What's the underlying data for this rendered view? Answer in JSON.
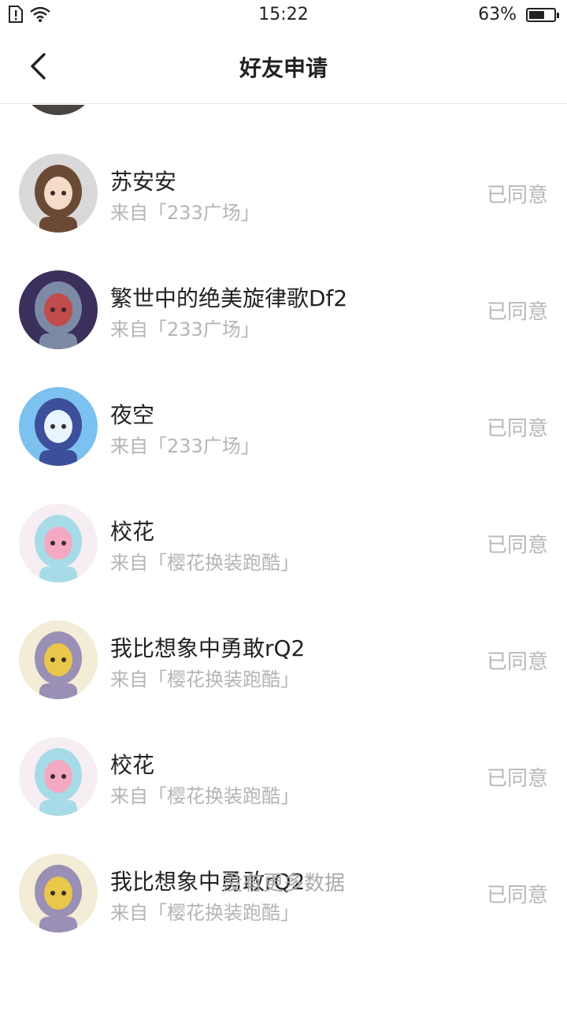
{
  "status_bar": {
    "time": "15:22",
    "battery": "63%",
    "battery_level": 0.63,
    "icons": [
      "sim-alert-icon",
      "wifi-icon",
      "battery-icon"
    ]
  },
  "header": {
    "title": "好友申请",
    "back_icon": "chevron-left-icon"
  },
  "requests": [
    {
      "name": "苏安安",
      "source": "来自「233广场」",
      "status": "已同意",
      "avatar_colors": [
        "#d9d9d9",
        "#6b4a35",
        "#f4dcc8"
      ]
    },
    {
      "name": "繁世中的绝美旋律歌Df2",
      "source": "来自「233广场」",
      "status": "已同意",
      "avatar_colors": [
        "#3b2f5c",
        "#7d8aa6",
        "#c24b4b"
      ]
    },
    {
      "name": "夜空",
      "source": "来自「233广场」",
      "status": "已同意",
      "avatar_colors": [
        "#7cc1ef",
        "#3d4f9a",
        "#e8f4ff"
      ]
    },
    {
      "name": "校花",
      "source": "来自「樱花换装跑酷」",
      "status": "已同意",
      "avatar_colors": [
        "#f6eef2",
        "#a8dbe8",
        "#f3a9c2"
      ]
    },
    {
      "name": "我比想象中勇敢rQ2",
      "source": "来自「樱花换装跑酷」",
      "status": "已同意",
      "avatar_colors": [
        "#f3ecd6",
        "#9a8fb4",
        "#e8c74a"
      ]
    },
    {
      "name": "校花",
      "source": "来自「樱花换装跑酷」",
      "status": "已同意",
      "avatar_colors": [
        "#f6eef2",
        "#a8dbe8",
        "#f3a9c2"
      ]
    },
    {
      "name": "我比想象中勇敢rQ2",
      "source": "来自「樱花换装跑酷」",
      "status": "已同意",
      "avatar_colors": [
        "#f3ecd6",
        "#9a8fb4",
        "#e8c74a"
      ]
    }
  ],
  "footer": "没有更多数据"
}
